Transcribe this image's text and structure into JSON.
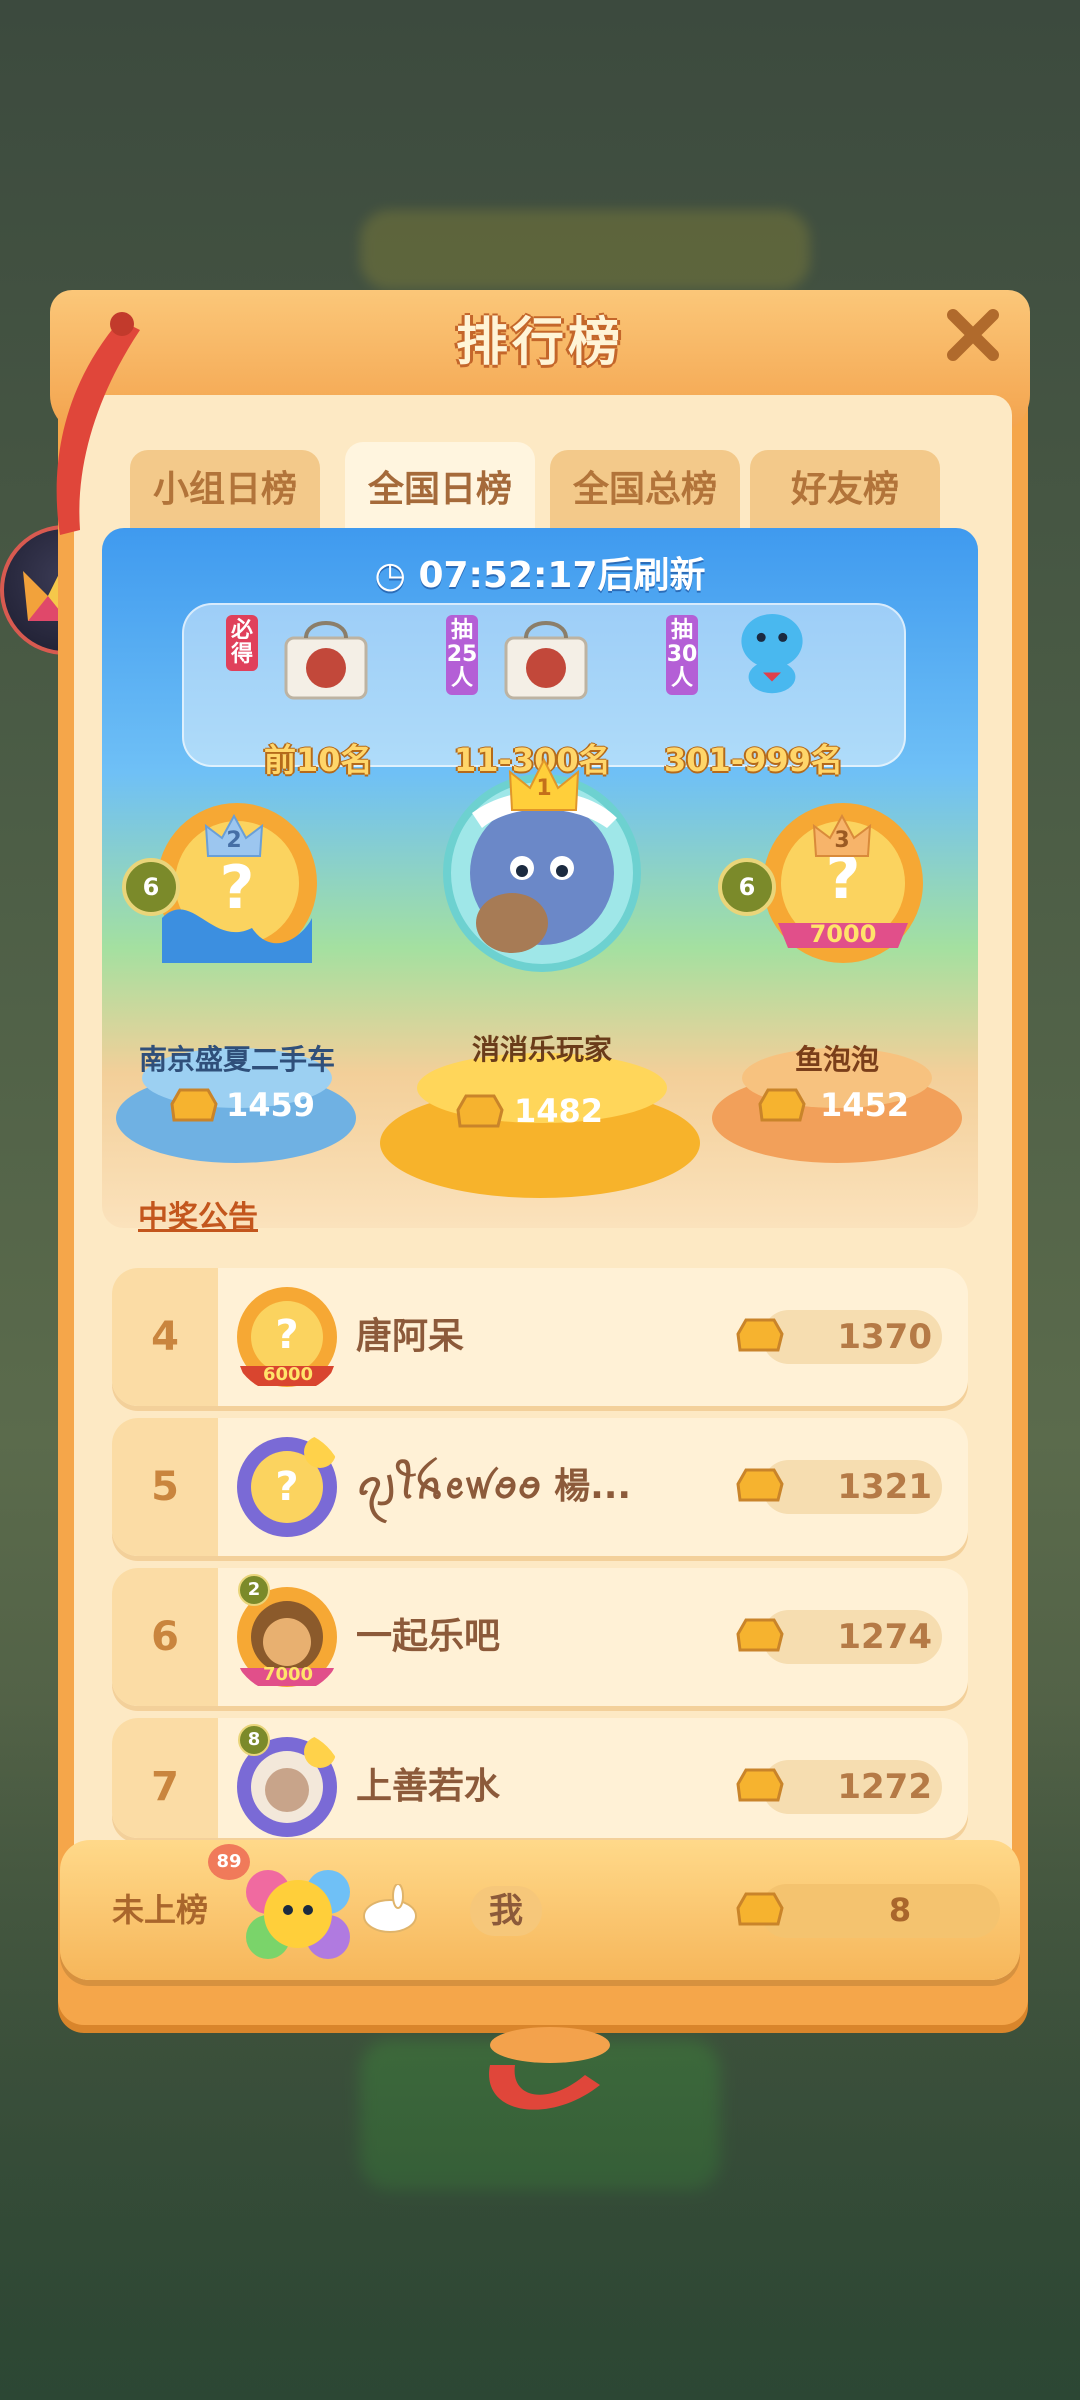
{
  "title": "排行榜",
  "tabs": [
    {
      "label": "小组日榜",
      "active": false
    },
    {
      "label": "全国日榜",
      "active": true
    },
    {
      "label": "全国总榜",
      "active": false
    },
    {
      "label": "好友榜",
      "active": false
    }
  ],
  "refresh_text": "07:52:17后刷新",
  "prizes": [
    {
      "tag": "必得",
      "range": "前10名"
    },
    {
      "tag": "抽25人",
      "range": "11-300名"
    },
    {
      "tag": "抽30人",
      "range": "301-999名"
    }
  ],
  "podium": [
    {
      "rank": "2",
      "name": "南京盛夏二手车",
      "score": "1459",
      "level": "6"
    },
    {
      "rank": "1",
      "name": "消消乐玩家",
      "score": "1482"
    },
    {
      "rank": "3",
      "name": "鱼泡泡",
      "score": "1452",
      "level": "6",
      "frame_label": "7000"
    }
  ],
  "notice": "中奖公告",
  "rows": [
    {
      "rank": "4",
      "name": "唐阿呆",
      "score": "1370",
      "frame_label": "6000"
    },
    {
      "rank": "5",
      "name": "ꪖ꠸ꪻꫝꫀꪝꪮꪮ 楊...",
      "score": "1321"
    },
    {
      "rank": "6",
      "name": "一起乐吧",
      "score": "1274",
      "level": "2",
      "frame_label": "7000"
    },
    {
      "rank": "7",
      "name": "上善若水",
      "score": "1272",
      "level": "8"
    }
  ],
  "me": {
    "rank": "未上榜",
    "name": "我",
    "score": "8",
    "level": "89"
  },
  "colors": {
    "panel": "#f5a64a",
    "gold": "#f6b32f",
    "blue_board": "#3f9aef"
  }
}
